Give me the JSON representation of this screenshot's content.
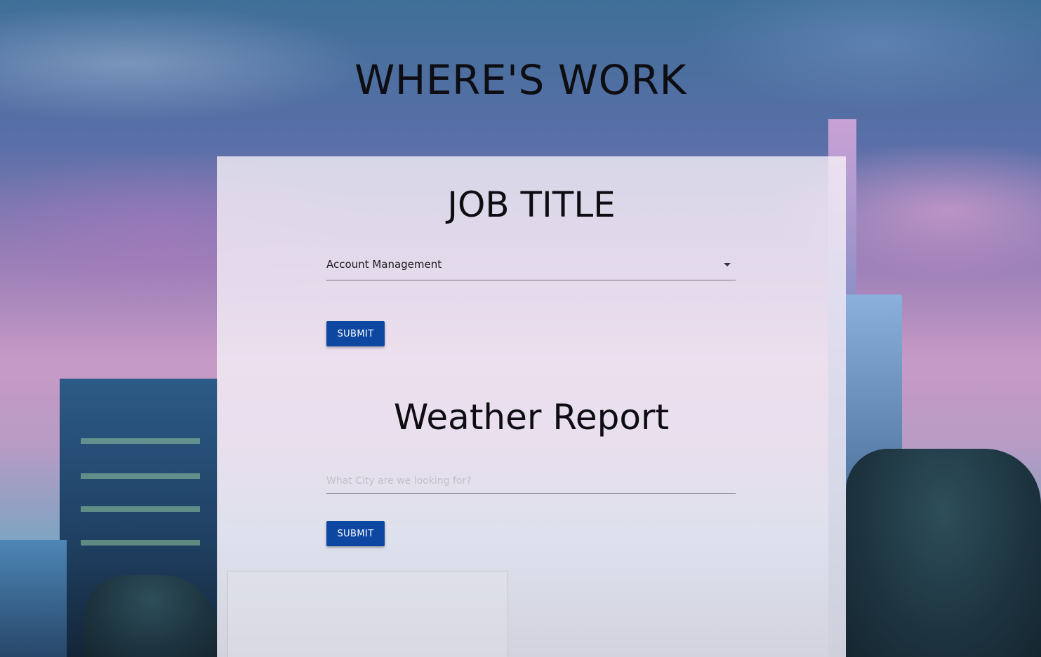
{
  "app": {
    "title": "WHERE'S WORK"
  },
  "job": {
    "heading": "JOB TITLE",
    "selected": "Account Management",
    "submit_label": "SUBMIT"
  },
  "weather": {
    "heading": "Weather Report",
    "placeholder": "What City are we looking for?",
    "value": "",
    "submit_label": "SUBMIT"
  },
  "colors": {
    "button": "#0d47a1",
    "card": "rgba(245,240,248,0.80)"
  }
}
